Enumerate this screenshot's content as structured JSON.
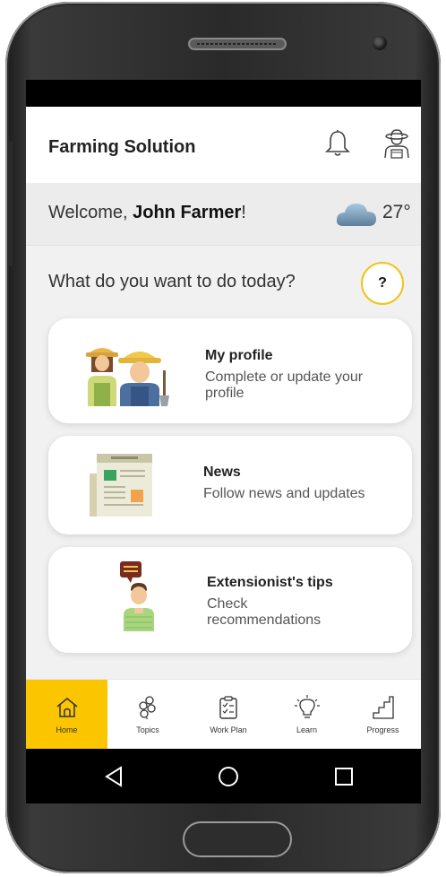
{
  "app": {
    "title": "Farming Solution"
  },
  "header": {
    "notifications_icon": "bell-icon",
    "profile_icon": "farmer-icon"
  },
  "welcome": {
    "prefix": "Welcome, ",
    "name": "John Farmer",
    "suffix": "!",
    "weather_icon": "cloud-icon",
    "temperature": "27°"
  },
  "prompt": {
    "question": "What do you want to do today?",
    "help_label": "?"
  },
  "cards": [
    {
      "title": "My profile",
      "description": "Complete or update your profile",
      "icon": "farmers-illustration"
    },
    {
      "title": "News",
      "description": "Follow news and updates",
      "icon": "newspaper-illustration"
    },
    {
      "title": "Extensionist's tips",
      "description": "Check recommendations",
      "icon": "extensionist-illustration"
    }
  ],
  "bottom_nav": [
    {
      "label": "Home",
      "icon": "home-icon",
      "active": true
    },
    {
      "label": "Topics",
      "icon": "topics-icon",
      "active": false
    },
    {
      "label": "Work Plan",
      "icon": "clipboard-icon",
      "active": false
    },
    {
      "label": "Learn",
      "icon": "lightbulb-icon",
      "active": false
    },
    {
      "label": "Progress",
      "icon": "stairs-icon",
      "active": false
    }
  ],
  "colors": {
    "accent": "#fbc600",
    "help_ring": "#f0c419",
    "background": "#f1f1f1"
  }
}
